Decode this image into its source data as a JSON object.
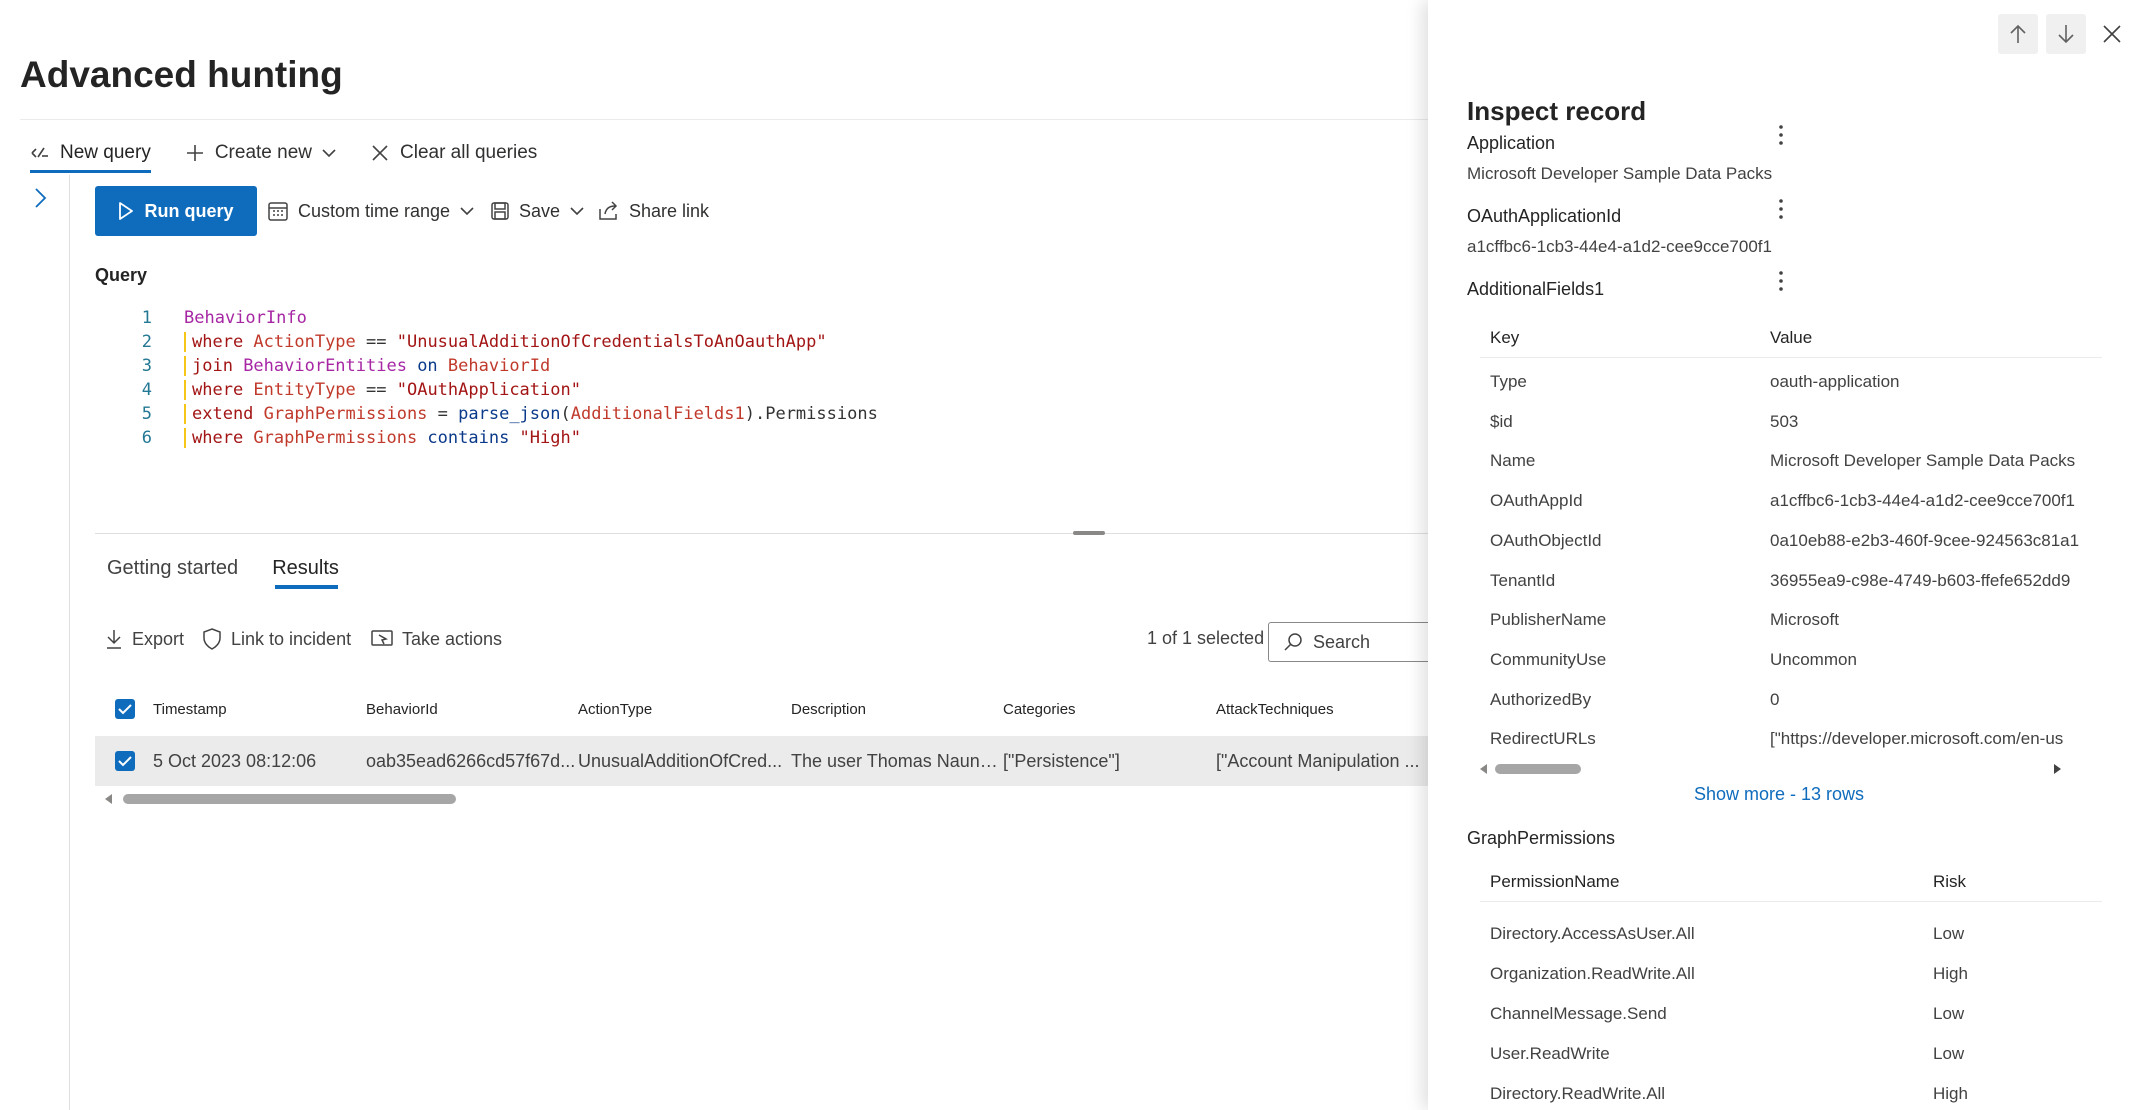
{
  "page": {
    "title": "Advanced hunting"
  },
  "top_tabs": {
    "new_query": "New query",
    "create_new": "Create new",
    "clear_all": "Clear all queries"
  },
  "toolbar": {
    "run_query": "Run query",
    "time_range": "Custom time range",
    "save": "Save",
    "share_link": "Share link"
  },
  "query": {
    "label": "Query",
    "lines": [
      {
        "n": "1",
        "parts": [
          [
            "tb",
            "BehaviorInfo"
          ]
        ]
      },
      {
        "n": "2",
        "parts": [
          [
            "kw",
            "| where "
          ],
          [
            "col",
            "ActionType"
          ],
          [
            "op",
            " == "
          ],
          [
            "str",
            "\"UnusualAdditionOfCredentialsToAnOauthApp\""
          ]
        ]
      },
      {
        "n": "3",
        "parts": [
          [
            "kw",
            "| join "
          ],
          [
            "tb",
            "BehaviorEntities"
          ],
          [
            "fn",
            " on "
          ],
          [
            "col",
            "BehaviorId"
          ]
        ]
      },
      {
        "n": "4",
        "parts": [
          [
            "kw",
            "| where "
          ],
          [
            "col",
            "EntityType"
          ],
          [
            "op",
            " == "
          ],
          [
            "str",
            "\"OAuthApplication\""
          ]
        ]
      },
      {
        "n": "5",
        "parts": [
          [
            "kw",
            "| extend "
          ],
          [
            "col",
            "GraphPermissions"
          ],
          [
            "op",
            " = "
          ],
          [
            "fn",
            "parse_json"
          ],
          [
            "op",
            "("
          ],
          [
            "col",
            "AdditionalFields1"
          ],
          [
            "op",
            ").Permissions"
          ]
        ]
      },
      {
        "n": "6",
        "parts": [
          [
            "kw",
            "| where "
          ],
          [
            "col",
            "GraphPermissions"
          ],
          [
            "fn",
            " contains "
          ],
          [
            "str",
            "\"High\""
          ]
        ]
      }
    ]
  },
  "results_tabs": {
    "getting_started": "Getting started",
    "results": "Results"
  },
  "actions": {
    "export": "Export",
    "link_incident": "Link to incident",
    "take_actions": "Take actions",
    "selected": "1 of 1 selected",
    "search_placeholder": "Search"
  },
  "grid": {
    "headers": [
      "Timestamp",
      "BehaviorId",
      "ActionType",
      "Description",
      "Categories",
      "AttackTechniques"
    ],
    "row": [
      "5 Oct 2023 08:12:06",
      "oab35ead6266cd57f67d...",
      "UnusualAdditionOfCred...",
      "The user Thomas Naunh...",
      "[\"Persistence\"]",
      "[\"Account Manipulation ..."
    ]
  },
  "panel": {
    "title": "Inspect record",
    "application_label": "Application",
    "application_value": "Microsoft Developer Sample Data Packs",
    "oauth_label": "OAuthApplicationId",
    "oauth_value": "a1cffbc6-1cb3-44e4-a1d2-cee9cce700f1",
    "additional_label": "AdditionalFields1",
    "kv_headers": {
      "key": "Key",
      "value": "Value"
    },
    "kv_rows": [
      {
        "k": "Type",
        "v": "oauth-application"
      },
      {
        "k": "$id",
        "v": "503"
      },
      {
        "k": "Name",
        "v": "Microsoft Developer Sample Data Packs"
      },
      {
        "k": "OAuthAppId",
        "v": "a1cffbc6-1cb3-44e4-a1d2-cee9cce700f1"
      },
      {
        "k": "OAuthObjectId",
        "v": "0a10eb88-e2b3-460f-9cee-924563c81a1"
      },
      {
        "k": "TenantId",
        "v": "36955ea9-c98e-4749-b603-ffefe652dd9"
      },
      {
        "k": "PublisherName",
        "v": "Microsoft"
      },
      {
        "k": "CommunityUse",
        "v": "Uncommon"
      },
      {
        "k": "AuthorizedBy",
        "v": "0"
      },
      {
        "k": "RedirectURLs",
        "v": "[\"https://developer.microsoft.com/en-us"
      }
    ],
    "show_more": "Show more - 13 rows",
    "graph_label": "GraphPermissions",
    "gp_headers": {
      "name": "PermissionName",
      "risk": "Risk"
    },
    "gp_rows": [
      {
        "k": "Directory.AccessAsUser.All",
        "v": "Low"
      },
      {
        "k": "Organization.ReadWrite.All",
        "v": "High"
      },
      {
        "k": "ChannelMessage.Send",
        "v": "Low"
      },
      {
        "k": "User.ReadWrite",
        "v": "Low"
      },
      {
        "k": "Directory.ReadWrite.All",
        "v": "High"
      }
    ]
  },
  "colors": {
    "accent": "#0f6cbd",
    "row_selected": "#ebebeb"
  }
}
